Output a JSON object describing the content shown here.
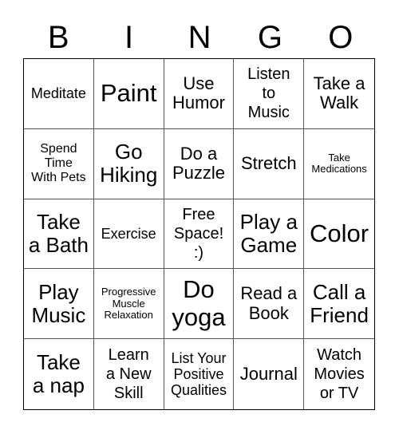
{
  "header": [
    "B",
    "I",
    "N",
    "G",
    "O"
  ],
  "cells": [
    {
      "text": "Meditate",
      "size": "s-s"
    },
    {
      "text": "Paint",
      "size": "s-xl"
    },
    {
      "text": "Use Humor",
      "size": "s-m"
    },
    {
      "text": "Listen to Music",
      "size": "s-ms"
    },
    {
      "text": "Take a Walk",
      "size": "s-m"
    },
    {
      "text": "Spend Time With Pets",
      "size": "s-xs"
    },
    {
      "text": "Go Hiking",
      "size": "s-l"
    },
    {
      "text": "Do a Puzzle",
      "size": "s-m"
    },
    {
      "text": "Stretch",
      "size": "s-m"
    },
    {
      "text": "Take Medications",
      "size": "s-xxs"
    },
    {
      "text": "Take a Bath",
      "size": "s-l"
    },
    {
      "text": "Exercise",
      "size": "s-s"
    },
    {
      "text": "Free Space! :)",
      "size": "s-ms"
    },
    {
      "text": "Play a Game",
      "size": "s-l"
    },
    {
      "text": "Color",
      "size": "s-xl"
    },
    {
      "text": "Play Music",
      "size": "s-l"
    },
    {
      "text": "Progressive Muscle Relaxation",
      "size": "s-xxs"
    },
    {
      "text": "Do yoga",
      "size": "s-xl"
    },
    {
      "text": "Read a Book",
      "size": "s-m"
    },
    {
      "text": "Call a Friend",
      "size": "s-l"
    },
    {
      "text": "Take a nap",
      "size": "s-l"
    },
    {
      "text": "Learn a New Skill",
      "size": "s-ms"
    },
    {
      "text": "List Your Positive Qualities",
      "size": "s-s"
    },
    {
      "text": "Journal",
      "size": "s-m"
    },
    {
      "text": "Watch Movies or TV",
      "size": "s-ms"
    }
  ]
}
